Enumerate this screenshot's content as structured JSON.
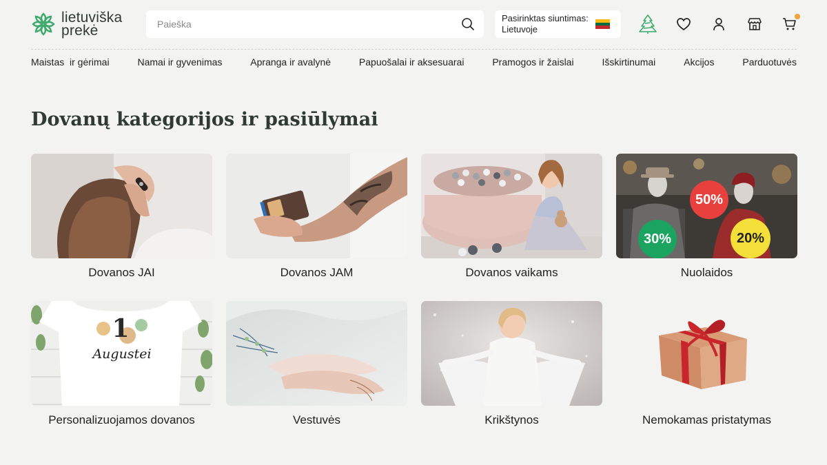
{
  "logo": {
    "line1": "lietuviška",
    "line2": "prekė"
  },
  "search": {
    "placeholder": "Paieška"
  },
  "shipping": {
    "label": "Pasirinktas siuntimas:",
    "country": "Lietuvoje",
    "flag_colors": [
      "#FDB913",
      "#006A44",
      "#C1272D"
    ]
  },
  "header_icons": [
    "christmas-tree-icon",
    "heart-icon",
    "user-icon",
    "store-icon",
    "cart-icon"
  ],
  "nav": [
    "Maistas  ir gėrimai",
    "Namai ir gyvenimas",
    "Apranga ir avalynė",
    "Papuošalai ir aksesuarai",
    "Pramogos ir žaislai",
    "Išskirtinumai",
    "Akcijos",
    "Parduotuvės"
  ],
  "page_title": "Dovanų kategorijos ir pasiūlymai",
  "categories": [
    {
      "label": "Dovanos JAI"
    },
    {
      "label": "Dovanos JAM"
    },
    {
      "label": "Dovanos vaikams"
    },
    {
      "label": "Nuolaidos",
      "badges": [
        "50%",
        "30%",
        "20%"
      ]
    },
    {
      "label": "Personalizuojamos dovanos",
      "print": "Augustei",
      "number": "1"
    },
    {
      "label": "Vestuvės"
    },
    {
      "label": "Krikštynos"
    },
    {
      "label": "Nemokamas pristatymas"
    }
  ],
  "colors": {
    "brand_green": "#3daa6b",
    "background": "#f3f3f2",
    "cart_badge": "#f2a33a"
  }
}
